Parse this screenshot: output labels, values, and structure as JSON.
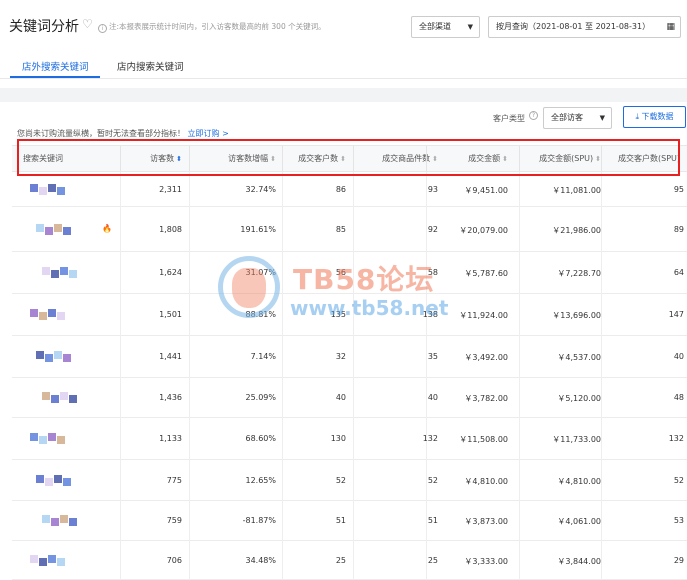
{
  "header": {
    "title": "关键词分析",
    "notice": "注:本报表展示统计时间内，引入访客数最高的前 300 个关键词。",
    "channel_select": "全部渠道",
    "date_select": "按月查询（2021-08-01 至 2021-08-31）"
  },
  "tabs": [
    {
      "label": "店外搜索关键词",
      "active": true
    },
    {
      "label": "店内搜索关键词",
      "active": false
    }
  ],
  "toolbar": {
    "customer_type_label": "客户类型",
    "customer_type_value": "全部访客",
    "download_label": "下载数据",
    "warning_text": "您尚未订购流量纵横，暂时无法查看部分指标！",
    "warning_link": "立即订购 >"
  },
  "table": {
    "columns": [
      "搜索关键词",
      "访客数",
      "访客数增幅",
      "成交客户数",
      "成交商品件数",
      "成交金额",
      "成交金额(SPU)",
      "成交客户数(SPU)"
    ],
    "rows": [
      {
        "visitors": "2,311",
        "growth": "32.74%",
        "customers": "86",
        "items": "93",
        "amount": "￥9,451.00",
        "amount_spu": "￥11,081.00",
        "customers_spu": "95",
        "hot": false
      },
      {
        "visitors": "1,808",
        "growth": "191.61%",
        "customers": "85",
        "items": "92",
        "amount": "￥20,079.00",
        "amount_spu": "￥21,986.00",
        "customers_spu": "89",
        "hot": true
      },
      {
        "visitors": "1,624",
        "growth": "31.07%",
        "customers": "56",
        "items": "58",
        "amount": "￥5,787.60",
        "amount_spu": "￥7,228.70",
        "customers_spu": "64",
        "hot": false
      },
      {
        "visitors": "1,501",
        "growth": "88.81%",
        "customers": "135",
        "items": "138",
        "amount": "￥11,924.00",
        "amount_spu": "￥13,696.00",
        "customers_spu": "147",
        "hot": false
      },
      {
        "visitors": "1,441",
        "growth": "7.14%",
        "customers": "32",
        "items": "35",
        "amount": "￥3,492.00",
        "amount_spu": "￥4,537.00",
        "customers_spu": "40",
        "hot": false
      },
      {
        "visitors": "1,436",
        "growth": "25.09%",
        "customers": "40",
        "items": "40",
        "amount": "￥3,782.00",
        "amount_spu": "￥5,120.00",
        "customers_spu": "48",
        "hot": false
      },
      {
        "visitors": "1,133",
        "growth": "68.60%",
        "customers": "130",
        "items": "132",
        "amount": "￥11,508.00",
        "amount_spu": "￥11,733.00",
        "customers_spu": "132",
        "hot": false
      },
      {
        "visitors": "775",
        "growth": "12.65%",
        "customers": "52",
        "items": "52",
        "amount": "￥4,810.00",
        "amount_spu": "￥4,810.00",
        "customers_spu": "52",
        "hot": false
      },
      {
        "visitors": "759",
        "growth": "-81.87%",
        "customers": "51",
        "items": "51",
        "amount": "￥3,873.00",
        "amount_spu": "￥4,061.00",
        "customers_spu": "53",
        "hot": false
      },
      {
        "visitors": "706",
        "growth": "34.48%",
        "customers": "25",
        "items": "25",
        "amount": "￥3,333.00",
        "amount_spu": "￥3,844.00",
        "customers_spu": "29",
        "hot": false
      }
    ]
  },
  "watermark": {
    "title": "TB58论坛",
    "url": "www.tb58.net"
  },
  "colors": {
    "accent": "#1d6de0",
    "highlight": "#e8201f",
    "hot": "#e2231a"
  }
}
